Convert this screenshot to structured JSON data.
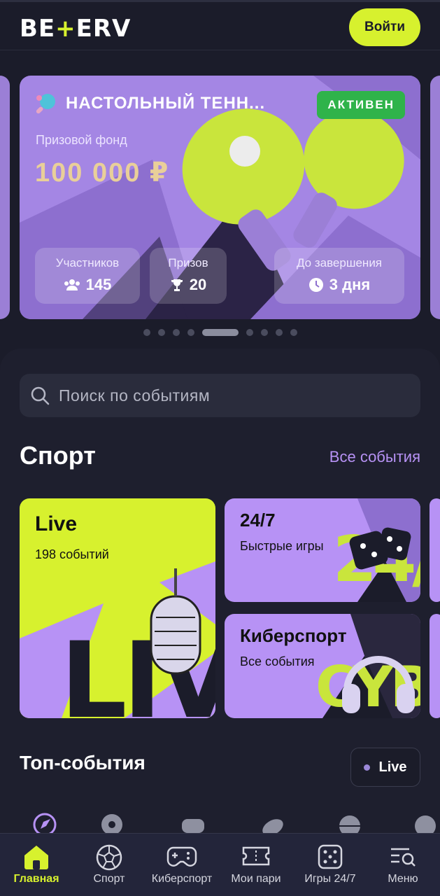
{
  "header": {
    "logo_left": "BE",
    "logo_plus": "+",
    "logo_right": "ERV",
    "login_label": "Войти"
  },
  "promo": {
    "title": "НАСТОЛЬНЫЙ ТЕНН...",
    "status": "АКТИВЕН",
    "prize_label": "Призовой фонд",
    "prize_value": "100 000 ₽",
    "stats": {
      "participants_label": "Участников",
      "participants_value": "145",
      "prizes_label": "Призов",
      "prizes_value": "20",
      "end_label": "До завершения",
      "end_value": "3 дня"
    },
    "carousel_dots_total": 9,
    "carousel_active_index": 4
  },
  "search": {
    "placeholder": "Поиск по событиям"
  },
  "sport": {
    "title": "Спорт",
    "all_events": "Все события",
    "tiles": {
      "live_title": "Live",
      "live_sub": "198 событий",
      "games_title": "24/7",
      "games_sub": "Быстрые игры",
      "cyber_title": "Киберспорт",
      "cyber_sub": "Все события"
    }
  },
  "top_events": {
    "title": "Топ-события",
    "live_chip": "Live"
  },
  "nav": {
    "items": [
      {
        "label": "Главная",
        "icon": "home-icon",
        "active": true
      },
      {
        "label": "Спорт",
        "icon": "soccer-ball-icon",
        "active": false
      },
      {
        "label": "Киберспорт",
        "icon": "gamepad-icon",
        "active": false
      },
      {
        "label": "Мои пари",
        "icon": "ticket-icon",
        "active": false
      },
      {
        "label": "Игры 24/7",
        "icon": "dice-icon",
        "active": false
      },
      {
        "label": "Меню",
        "icon": "menu-search-icon",
        "active": false
      }
    ]
  },
  "colors": {
    "background": "#1b1c2a",
    "accent_lime": "#d7f12e",
    "accent_purple": "#b792f5",
    "active_green": "#2fb34a",
    "prize_gold": "#e9cf99"
  }
}
